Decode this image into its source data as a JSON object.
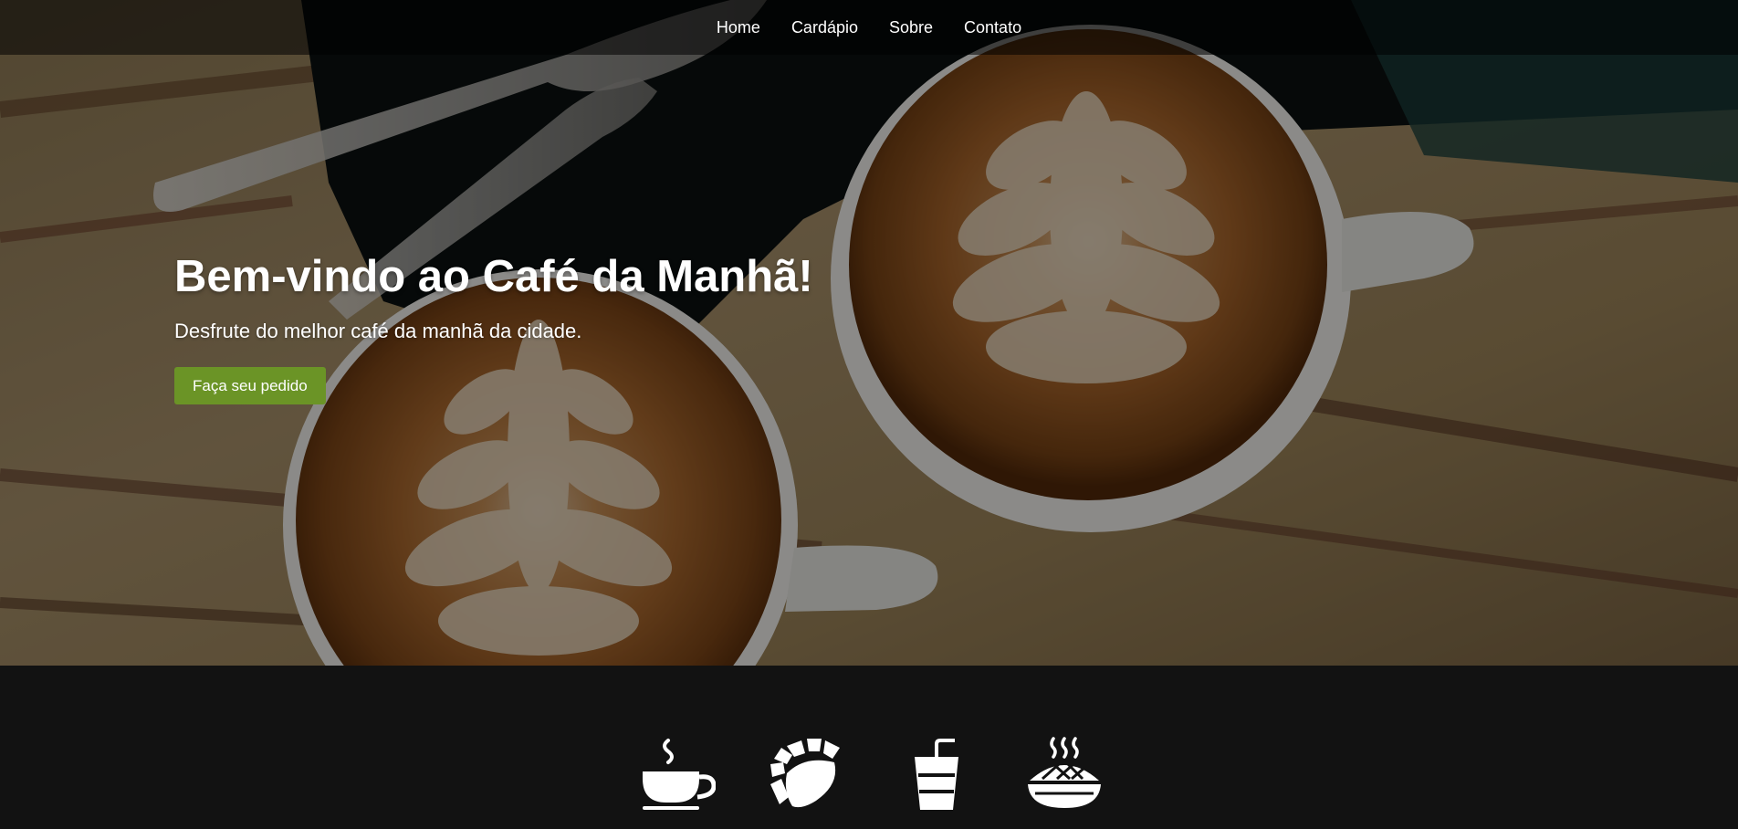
{
  "nav": {
    "items": [
      {
        "label": "Home"
      },
      {
        "label": "Cardápio"
      },
      {
        "label": "Sobre"
      },
      {
        "label": "Contato"
      }
    ]
  },
  "hero": {
    "title": "Bem-vindo ao Café da Manhã!",
    "subtitle": "Desfrute do melhor café da manhã da cidade.",
    "cta_label": "Faça seu pedido",
    "background": "two-latte-art-cups-on-wooden-table",
    "cta_color": "#6b9426"
  },
  "features": {
    "icons": [
      {
        "name": "coffee-cup-icon"
      },
      {
        "name": "pastry-icon"
      },
      {
        "name": "drink-cup-with-straw-icon"
      },
      {
        "name": "hot-pie-icon"
      }
    ]
  }
}
